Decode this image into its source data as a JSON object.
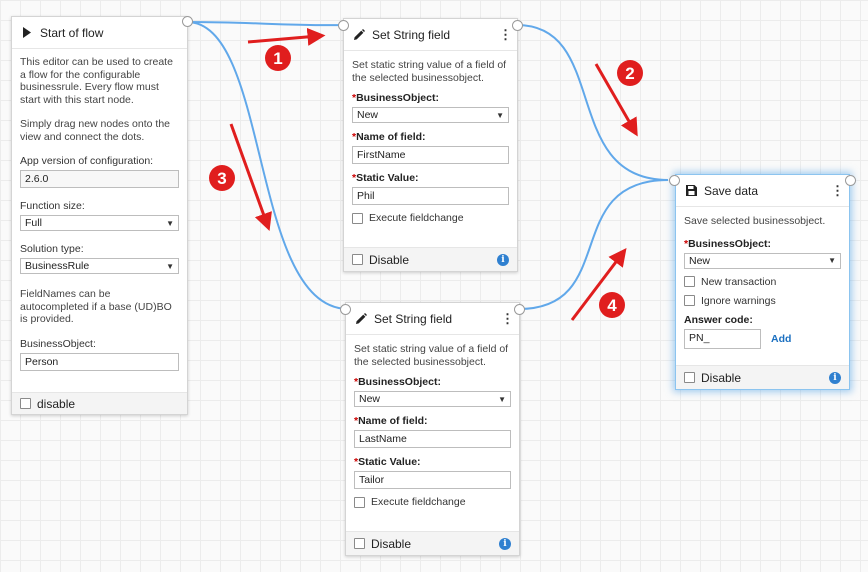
{
  "colors": {
    "wire": "#61a8ea",
    "annotation_red": "#e01e1e",
    "info_blue": "#2f80d0"
  },
  "start_node": {
    "icon": "play-icon",
    "title": "Start of flow",
    "description": "This editor can be used to create a flow for the configurable businessrule. Every flow must start with this start node.",
    "description2": "Simply drag new nodes onto the view and connect the dots.",
    "app_version_label": "App version of configuration:",
    "app_version_value": "2.6.0",
    "function_size_label": "Function size:",
    "function_size_value": "Full",
    "solution_type_label": "Solution type:",
    "solution_type_value": "BusinessRule",
    "fieldnames_note": "FieldNames can be autocompleted if a base (UD)BO is provided.",
    "businessobject_label": "BusinessObject:",
    "businessobject_value": "Person",
    "disable_label": "disable"
  },
  "set_string_1": {
    "icon": "pencil-icon",
    "title": "Set String field",
    "description": "Set static string value of a field of the selected businessobject.",
    "bo_label": "BusinessObject:",
    "bo_value": "New",
    "name_label": "Name of field:",
    "name_value": "FirstName",
    "static_label": "Static Value:",
    "static_value": "Phil",
    "fieldchange_label": "Execute fieldchange",
    "disable_label": "Disable"
  },
  "set_string_2": {
    "icon": "pencil-icon",
    "title": "Set String field",
    "description": "Set static string value of a field of the selected businessobject.",
    "bo_label": "BusinessObject:",
    "bo_value": "New",
    "name_label": "Name of field:",
    "name_value": "LastName",
    "static_label": "Static Value:",
    "static_value": "Tailor",
    "fieldchange_label": "Execute fieldchange",
    "disable_label": "Disable"
  },
  "save_data": {
    "icon": "floppy-disk-icon",
    "title": "Save data",
    "description": "Save selected businessobject.",
    "bo_label": "BusinessObject:",
    "bo_value": "New",
    "new_transaction_label": "New transaction",
    "ignore_warnings_label": "Ignore warnings",
    "answer_code_label": "Answer code:",
    "answer_code_value": "PN_",
    "add_label": "Add",
    "disable_label": "Disable"
  },
  "annotations": [
    "1",
    "2",
    "3",
    "4"
  ]
}
